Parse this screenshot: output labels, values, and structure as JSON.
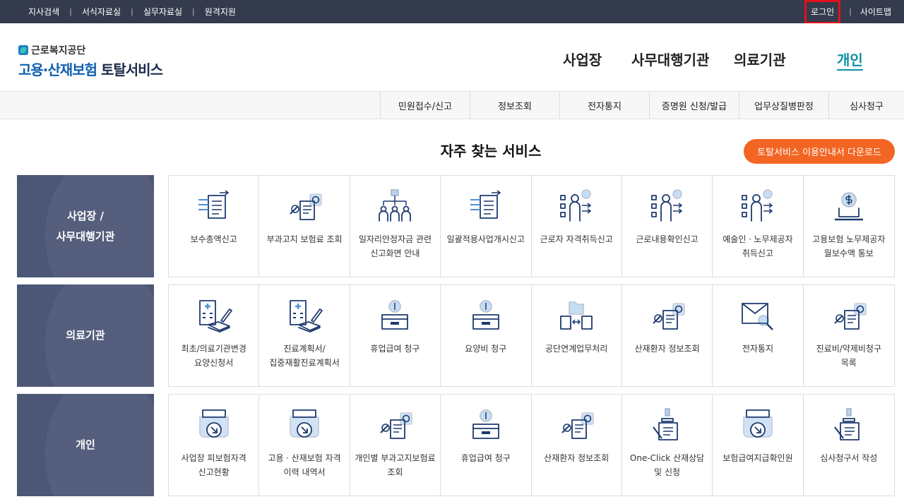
{
  "topbar": {
    "links": [
      "지사검색",
      "서식자료실",
      "실무자료실",
      "원격지원"
    ],
    "login": "로그인",
    "sitemap": "사이트맵"
  },
  "logo": {
    "org": "근로복지공단",
    "title_blue": "고용·산재보험",
    "title_dark": " 토탈서비스"
  },
  "mainnav": [
    "사업장",
    "사무대행기관",
    "의료기관",
    "개인"
  ],
  "subnav": [
    "민원접수/신고",
    "정보조회",
    "전자통지",
    "증명원 신청/발급",
    "업무상질병판정",
    "심사청구"
  ],
  "section": {
    "title": "자주 찾는 서비스",
    "guide_button": "토탈서비스 이용안내서 다운로드"
  },
  "rows": [
    {
      "category_lines": [
        "사업장 /",
        "사무대행기관"
      ],
      "items": [
        {
          "label": "보수총액신고",
          "icon": "document-arrows-icon"
        },
        {
          "label": "부과고지 보험료 조회",
          "icon": "document-magnifier-icon"
        },
        {
          "label": "일자리안정자금 관련 신고화면 안내",
          "icon": "org-chart-people-icon"
        },
        {
          "label": "일괄적용사업개시신고",
          "icon": "document-arrows-icon"
        },
        {
          "label": "근로자 자격취득신고",
          "icon": "person-checklist-icon"
        },
        {
          "label": "근로내용확인신고",
          "icon": "person-checklist-icon"
        },
        {
          "label": "예술인ㆍ노무제공자 취득신고",
          "icon": "person-checklist-icon"
        },
        {
          "label": "고용보험 노무제공자 월보수액 통보",
          "icon": "coin-laptop-icon"
        }
      ]
    },
    {
      "category_lines": [
        "의료기관"
      ],
      "items": [
        {
          "label": "최초/의료기관변경 요양신청서",
          "icon": "hospital-pen-icon"
        },
        {
          "label": "진료계획서/집중재활진료계획서",
          "icon": "hospital-pen-icon"
        },
        {
          "label": "휴업급여 청구",
          "icon": "money-box-icon"
        },
        {
          "label": "요양비 청구",
          "icon": "money-box-icon"
        },
        {
          "label": "공단연계업무처리",
          "icon": "folder-exchange-icon"
        },
        {
          "label": "산재환자 정보조회",
          "icon": "document-magnifier-icon"
        },
        {
          "label": "전자통지",
          "icon": "envelope-search-icon"
        },
        {
          "label": "진료비/약제비청구 목록",
          "icon": "document-magnifier-icon"
        }
      ]
    },
    {
      "category_lines": [
        "개인"
      ],
      "items": [
        {
          "label": "사업장 피보험자격 신고현황",
          "icon": "printer-arrow-icon"
        },
        {
          "label": "고용ㆍ산재보험 자격 이력 내역서",
          "icon": "printer-arrow-icon"
        },
        {
          "label": "개인별 부과고지보험료 조회",
          "icon": "document-magnifier-icon"
        },
        {
          "label": "휴업급여 청구",
          "icon": "money-box-icon"
        },
        {
          "label": "산재환자 정보조회",
          "icon": "document-magnifier-icon"
        },
        {
          "label": "One-Click 산재상담 및 신청",
          "icon": "stamp-document-icon"
        },
        {
          "label": "보험급여지급확인원",
          "icon": "printer-arrow-icon"
        },
        {
          "label": "심사청구서 작성",
          "icon": "stamp-document-icon"
        }
      ]
    }
  ],
  "colors": {
    "topbar": "#343b4c",
    "category": "#4c5676",
    "accent": "#f26522",
    "active_nav": "#0b8fa5",
    "icon_dark": "#1d3a6e",
    "icon_light": "#4a90d9",
    "login_border": "#e0111a"
  }
}
